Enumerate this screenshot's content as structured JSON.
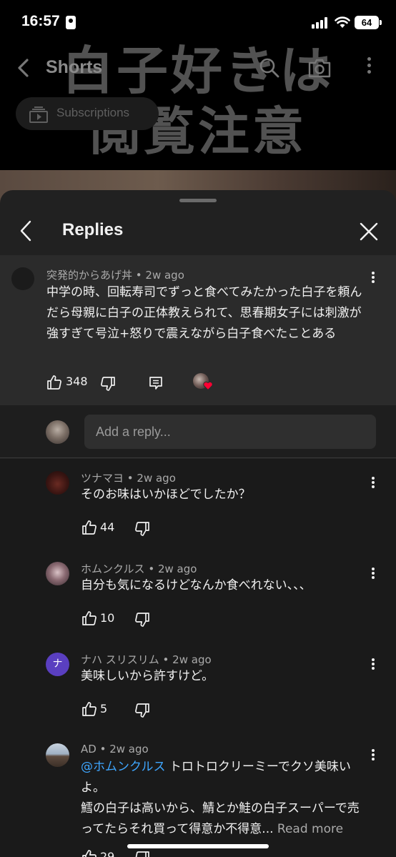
{
  "status_bar": {
    "time": "16:57",
    "battery": "64"
  },
  "top_nav": {
    "title": "Shorts"
  },
  "video": {
    "overlay_line1": "白子好きは",
    "overlay_line2": "閲覧注意"
  },
  "chips": {
    "subscriptions": "Subscriptions"
  },
  "sheet": {
    "title": "Replies"
  },
  "parent_comment": {
    "author": "突発的からあげ丼",
    "time": "2w ago",
    "text": "中学の時、回転寿司でずっと食べてみたかった白子を頼んだら母親に白子の正体教えられて、思春期女子には刺激が強すぎて号泣+怒りで震えながら白子食べたことある",
    "likes": "348"
  },
  "reply_input": {
    "placeholder": "Add a reply..."
  },
  "replies": [
    {
      "author": "ツナマヨ",
      "time": "2w ago",
      "text": "そのお味はいかほどでしたか？",
      "likes": "44"
    },
    {
      "author": "ホムンクルス",
      "time": "2w ago",
      "text": "自分も気になるけどなんか食べれない、、、",
      "likes": "10"
    },
    {
      "author": "ナハ スリスリム",
      "time": "2w ago",
      "avatar_letter": "ナ",
      "text": "美味しいから許すけど。",
      "likes": "5"
    },
    {
      "author": "AD",
      "time": "2w ago",
      "mention": "@ホムンクルス",
      "text_line1_rest": " トロトロクリーミーでクソ美味いよ。",
      "text_rest": "鱈の白子は高いから、鯖とか鮭の白子スーパーで売ってたらそれ買って得意か不得意...",
      "read_more": "Read more",
      "likes": "29"
    }
  ],
  "colors": {
    "sheet_bg": "#212121",
    "parent_bg": "#2b2b2b",
    "mention": "#3ea6ff",
    "heart": "#ff0033",
    "avatar_purple": "#5a3fc0"
  },
  "icons": [
    "back-arrow-icon",
    "search-icon",
    "camera-icon",
    "more-vert-icon",
    "subscriptions-icon",
    "close-icon",
    "like-icon",
    "dislike-icon",
    "reply-icon",
    "heart-icon"
  ]
}
